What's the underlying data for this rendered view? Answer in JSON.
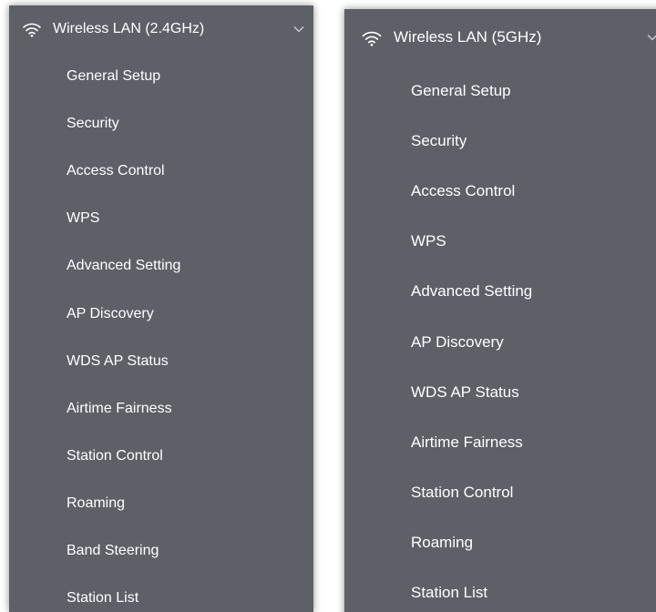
{
  "panels": [
    {
      "header": {
        "icon": "wifi-icon",
        "title": "Wireless LAN (2.4GHz)",
        "toggle_icon": "chevron-down-icon"
      },
      "items": [
        "General Setup",
        "Security",
        "Access Control",
        "WPS",
        "Advanced Setting",
        "AP Discovery",
        "WDS AP Status",
        "Airtime Fairness",
        "Station Control",
        "Roaming",
        "Band Steering",
        "Station List"
      ]
    },
    {
      "header": {
        "icon": "wifi-icon",
        "title": "Wireless LAN (5GHz)",
        "toggle_icon": "chevron-down-icon"
      },
      "items": [
        "General Setup",
        "Security",
        "Access Control",
        "WPS",
        "Advanced Setting",
        "AP Discovery",
        "WDS AP Status",
        "Airtime Fairness",
        "Station Control",
        "Roaming",
        "Station List"
      ]
    }
  ],
  "colors": {
    "panel_background": "#5d6066",
    "text": "#ffffff"
  }
}
